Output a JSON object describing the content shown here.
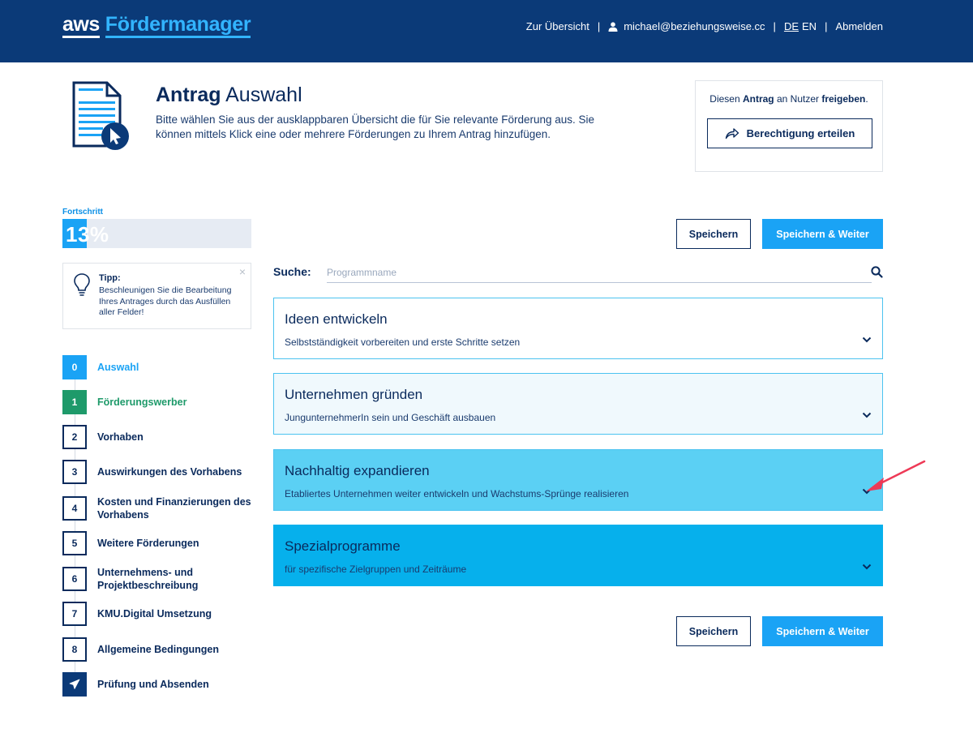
{
  "header": {
    "logo_aws": "aws",
    "logo_product": "Fördermanager",
    "nav_overview": "Zur Übersicht",
    "user_email": "michael@beziehungsweise.cc",
    "lang_de": "DE",
    "lang_en": "EN",
    "logout": "Abmelden",
    "separator": "|"
  },
  "intro": {
    "title_bold": "Antrag",
    "title_rest": " Auswahl",
    "description": "Bitte wählen Sie aus der ausklappbaren Übersicht die für Sie relevante Förderung aus. Sie können mittels Klick eine oder mehrere Förderungen zu Ihrem Antrag hinzufügen."
  },
  "share": {
    "text_pre": "Diesen ",
    "text_bold1": "Antrag",
    "text_mid": " an Nutzer ",
    "text_bold2": "freigeben",
    "text_post": ".",
    "button": "Berechtigung erteilen"
  },
  "progress": {
    "label": "Fortschritt",
    "percent_text": "13%",
    "value": 0.13
  },
  "tip": {
    "title": "Tipp:",
    "text": "Beschleunigen Sie die Bearbeitung Ihres Antrages durch das Ausfüllen aller Felder!",
    "close": "×"
  },
  "steps": [
    {
      "num": "0",
      "label": "Auswahl",
      "state": "active"
    },
    {
      "num": "1",
      "label": "Förderungswerber",
      "state": "done"
    },
    {
      "num": "2",
      "label": "Vorhaben",
      "state": "open"
    },
    {
      "num": "3",
      "label": "Auswirkungen des Vorhabens",
      "state": "open"
    },
    {
      "num": "4",
      "label": "Kosten und Finanzierungen des Vorhabens",
      "state": "open"
    },
    {
      "num": "5",
      "label": "Weitere Förderungen",
      "state": "open"
    },
    {
      "num": "6",
      "label": "Unternehmens- und Projektbeschreibung",
      "state": "open"
    },
    {
      "num": "7",
      "label": "KMU.Digital Umsetzung",
      "state": "open"
    },
    {
      "num": "8",
      "label": "Allgemeine Bedingungen",
      "state": "open"
    },
    {
      "num": "",
      "label": "Prüfung und Absenden",
      "state": "final"
    }
  ],
  "actions": {
    "save": "Speichern",
    "save_next": "Speichern & Weiter"
  },
  "search": {
    "label": "Suche:",
    "placeholder": "Programmname",
    "value": ""
  },
  "programs": [
    {
      "title": "Ideen entwickeln",
      "subtitle": "Selbstständigkeit vorbereiten und erste Schritte setzen"
    },
    {
      "title": "Unternehmen gründen",
      "subtitle": "JungunternehmerIn sein und Geschäft ausbauen"
    },
    {
      "title": "Nachhaltig expandieren",
      "subtitle": "Etabliertes Unternehmen weiter entwickeln und Wachstums-Sprünge realisieren"
    },
    {
      "title": "Spezialprogramme",
      "subtitle": "für spezifische Zielgruppen und Zeiträume"
    }
  ],
  "colors": {
    "header_bg": "#0b3a78",
    "accent": "#1aa3f5",
    "done": "#1e9a6a",
    "annotation_arrow": "#ee3a57"
  }
}
